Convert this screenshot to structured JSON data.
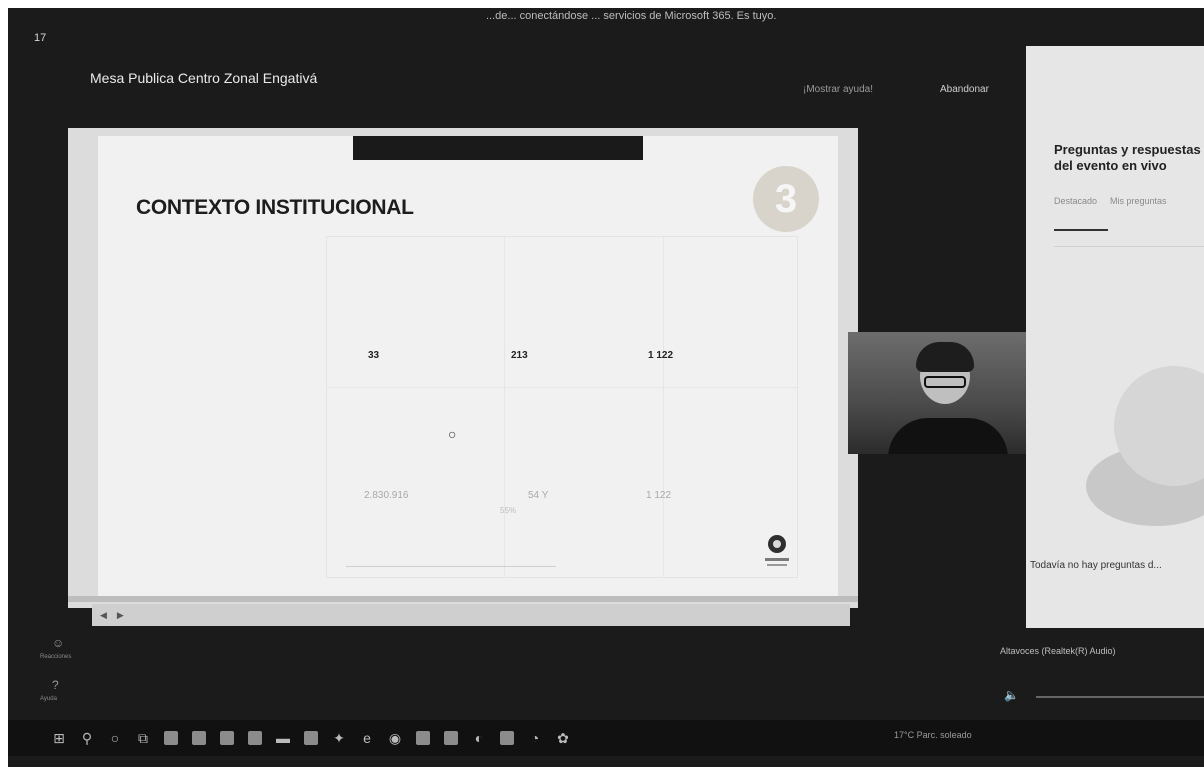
{
  "window": {
    "topbar_text": "...de... conectándose ... servicios de Microsoft 365. Es tuyo.",
    "side_number": "17"
  },
  "event": {
    "title": "Mesa Publica Centro Zonal Engativá",
    "link_reactions": "¡Mostrar ayuda!",
    "link_leave": "Abandonar"
  },
  "slide": {
    "heading": "CONTEXTO INSTITUCIONAL",
    "badge": "3",
    "stats": {
      "row1": [
        "33",
        "213",
        "1 122"
      ],
      "row2": [
        "2.830.916",
        "54 Y",
        "1 122"
      ],
      "row2_note": "55%"
    },
    "cursor_symbol": "○"
  },
  "qa": {
    "title": "Preguntas y respuestas del evento en vivo",
    "tab_featured": "Destacado",
    "tab_mine": "Mis preguntas",
    "empty_text": "Todavía no hay preguntas d..."
  },
  "audio": {
    "label": "Altavoces (Realtek(R) Audio)"
  },
  "rail": {
    "item1": "Reacciones",
    "item2": "Ayuda"
  },
  "taskbar": {
    "right_text": "17°C Parc. soleado"
  }
}
